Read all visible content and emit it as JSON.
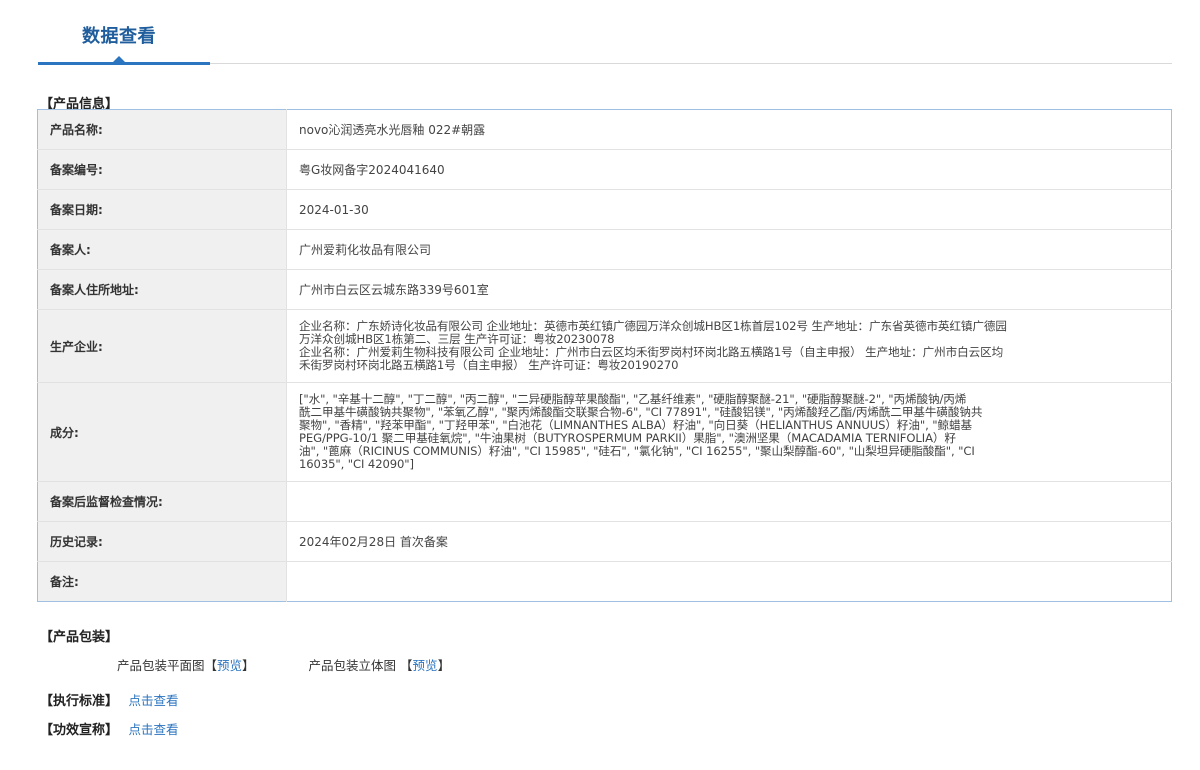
{
  "tab": {
    "label": "数据查看"
  },
  "sections": {
    "product_info": "【产品信息】",
    "packaging": "【产品包装】",
    "standard": "【执行标准】",
    "efficacy": "【功效宣称】"
  },
  "info": {
    "product_name": {
      "label": "产品名称:",
      "value": "novo沁润透亮水光唇釉 022#朝露"
    },
    "record_no": {
      "label": "备案编号:",
      "value": "粤G妆网备字2024041640"
    },
    "record_date": {
      "label": "备案日期:",
      "value": "2024-01-30"
    },
    "registrant": {
      "label": "备案人:",
      "value": "广州爱莉化妆品有限公司"
    },
    "registrant_address": {
      "label": "备案人住所地址:",
      "value": "广州市白云区云城东路339号601室"
    },
    "manufacturer": {
      "label": "生产企业:",
      "lines": [
        "企业名称：广东娇诗化妆品有限公司 企业地址：英德市英红镇广德园万洋众创城HB区1栋首层102号 生产地址：广东省英德市英红镇广德园",
        "万洋众创城HB区1栋第二、三层 生产许可证：粤妆20230078",
        "企业名称：广州爱莉生物科技有限公司 企业地址：广州市白云区均禾街罗岗村环岗北路五横路1号（自主申报） 生产地址：广州市白云区均",
        "禾街罗岗村环岗北路五横路1号（自主申报） 生产许可证：粤妆20190270"
      ]
    },
    "ingredients": {
      "label": "成分:",
      "lines": [
        "[\"水\", \"辛基十二醇\", \"丁二醇\", \"丙二醇\", \"二异硬脂醇苹果酸酯\", \"乙基纤维素\", \"硬脂醇聚醚-21\", \"硬脂醇聚醚-2\", \"丙烯酸钠/丙烯",
        "酰二甲基牛磺酸钠共聚物\", \"苯氧乙醇\", \"聚丙烯酸酯交联聚合物-6\", \"CI 77891\", \"硅酸铝镁\", \"丙烯酸羟乙酯/丙烯酰二甲基牛磺酸钠共",
        "聚物\", \"香精\", \"羟苯甲酯\", \"丁羟甲苯\", \"白池花（LIMNANTHES ALBA）籽油\", \"向日葵（HELIANTHUS ANNUUS）籽油\", \"鲸蜡基",
        "PEG/PPG-10/1 聚二甲基硅氧烷\", \"牛油果树（BUTYROSPERMUM PARKII）果脂\", \"澳洲坚果（MACADAMIA TERNIFOLIA）籽",
        "油\", \"蓖麻（RICINUS COMMUNIS）籽油\", \"CI 15985\", \"硅石\", \"氯化钠\", \"CI 16255\", \"聚山梨醇酯-60\", \"山梨坦异硬脂酸酯\", \"CI",
        "16035\", \"CI 42090\"]"
      ]
    },
    "supervision": {
      "label": "备案后监督检查情况:",
      "value": ""
    },
    "history": {
      "label": "历史记录:",
      "value": "2024年02月28日 首次备案"
    },
    "remarks": {
      "label": "备注:",
      "value": ""
    }
  },
  "packaging": {
    "flat_label": "产品包装平面图",
    "flat_bracket_open": "【",
    "flat_preview": "预览",
    "flat_bracket_close": "】",
    "threed_label": "产品包装立体图",
    "threed_bracket_open": "【",
    "threed_preview": "预览",
    "threed_bracket_close": "】"
  },
  "links": {
    "standard": "点击查看",
    "efficacy": "点击查看"
  },
  "colors": {
    "accent": "#2b74c0",
    "title": "#1f5d9c",
    "label_bg": "#f0f0f0",
    "table_border": "#9fc0e0"
  }
}
